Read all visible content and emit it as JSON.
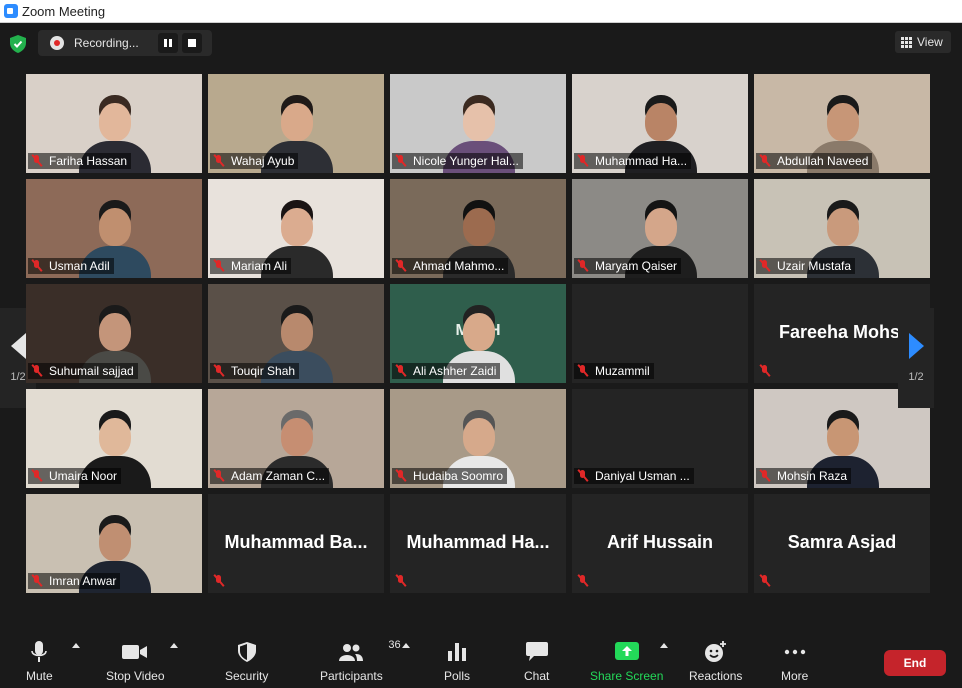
{
  "window": {
    "title": "Zoom Meeting"
  },
  "recording": {
    "label": "Recording..."
  },
  "view": {
    "label": "View"
  },
  "pagination": {
    "left": "1/2",
    "right": "1/2"
  },
  "participants": [
    {
      "name": "Fariha Hassan",
      "video": true,
      "bg": "#d9d0c8",
      "skin": "#e2b79b",
      "cloth": "#2b2b33",
      "hair": "#3a2a22"
    },
    {
      "name": "Wahaj Ayub",
      "video": true,
      "bg": "#b8a98e",
      "skin": "#d9a98a",
      "cloth": "#2d2f35",
      "hair": "#1f1a18",
      "active": true
    },
    {
      "name": "Nicole Yunger Hal...",
      "video": true,
      "bg": "#c9c9c9",
      "skin": "#e6c1aa",
      "cloth": "#6a4f7a",
      "hair": "#3b2a20"
    },
    {
      "name": "Muhammad Ha...",
      "video": true,
      "bg": "#d8d2cc",
      "skin": "#b98466",
      "cloth": "#1f1f22",
      "hair": "#1a1a1a"
    },
    {
      "name": "Abdullah Naveed",
      "video": true,
      "bg": "#c8b8a6",
      "skin": "#c79677",
      "cloth": "#8a7a6a",
      "hair": "#1a1a1a"
    },
    {
      "name": "Usman Adil",
      "video": true,
      "bg": "#8d6a58",
      "skin": "#c08f6f",
      "cloth": "#2e4a5f",
      "hair": "#1a1a1a"
    },
    {
      "name": "Mariam Ali",
      "video": true,
      "bg": "#e8e2dc",
      "skin": "#dbac90",
      "cloth": "#2a2a2a",
      "hair": "#1a1414"
    },
    {
      "name": "Ahmad Mahmo...",
      "video": true,
      "bg": "#7a6a5a",
      "skin": "#9c6b4f",
      "cloth": "#2a2a2a",
      "hair": "#111111"
    },
    {
      "name": "Maryam Qaiser",
      "video": true,
      "bg": "#8c8a86",
      "skin": "#d4a68a",
      "cloth": "#1e1e1e",
      "hair": "#141414"
    },
    {
      "name": "Uzair Mustafa",
      "video": true,
      "bg": "#c8c2b6",
      "skin": "#c99a7c",
      "cloth": "#2c3036",
      "hair": "#1a1a1a"
    },
    {
      "name": "Suhumail sajjad",
      "video": true,
      "bg": "#3a2e28",
      "skin": "#c4957a",
      "cloth": "#4a4a46",
      "hair": "#1a1a1a"
    },
    {
      "name": "Touqir Shah",
      "video": true,
      "bg": "#5a5048",
      "skin": "#b8896d",
      "cloth": "#3b4d5e",
      "hair": "#1a1a1a"
    },
    {
      "name": "Ali Ashher Zaidi",
      "video": true,
      "bg": "#2f5e4c",
      "skin": "#d8a98a",
      "cloth": "#e0e0e0",
      "hair": "#222222",
      "board": "MATH"
    },
    {
      "name": "Muzammil",
      "video": false
    },
    {
      "name": "Fareeha Mohsin",
      "video": false,
      "big": "Fareeha Mohsi",
      "noplate": true
    },
    {
      "name": "Umaira Noor",
      "video": true,
      "bg": "#e2dcd2",
      "skin": "#e0b89a",
      "cloth": "#1a1a1a",
      "hair": "#1a1a1a"
    },
    {
      "name": "Adam Zaman C...",
      "video": true,
      "bg": "#b7a798",
      "skin": "#c68e72",
      "cloth": "#2b2b2b",
      "hair": "#6a6a6a"
    },
    {
      "name": "Hudaiba Soomro",
      "video": true,
      "bg": "#a89a88",
      "skin": "#d6a98b",
      "cloth": "#e8e8e8",
      "hair": "#555555"
    },
    {
      "name": "Daniyal Usman ...",
      "video": false
    },
    {
      "name": "Mohsin Raza",
      "video": true,
      "bg": "#cfc8c2",
      "skin": "#c89674",
      "cloth": "#1d2230",
      "hair": "#1a1a1a"
    },
    {
      "name": "Imran Anwar",
      "video": true,
      "bg": "#c9c0b2",
      "skin": "#c08f72",
      "cloth": "#1e2430",
      "hair": "#1a1a1a"
    },
    {
      "name": "",
      "video": false,
      "big": "Muhammad  Ba..."
    },
    {
      "name": "",
      "video": false,
      "big": "Muhammad  Ha..."
    },
    {
      "name": "",
      "video": false,
      "big": "Arif Hussain"
    },
    {
      "name": "",
      "video": false,
      "big": "Samra Asjad"
    }
  ],
  "toolbar": {
    "mute": "Mute",
    "stop_video": "Stop Video",
    "security": "Security",
    "participants": "Participants",
    "participants_count": "36",
    "polls": "Polls",
    "chat": "Chat",
    "share_screen": "Share Screen",
    "reactions": "Reactions",
    "more": "More",
    "end": "End"
  },
  "colors": {
    "share_green": "#23d959",
    "end_red": "#c5242b",
    "active_border": "#c9e86d",
    "accent_blue": "#2d8cff"
  }
}
